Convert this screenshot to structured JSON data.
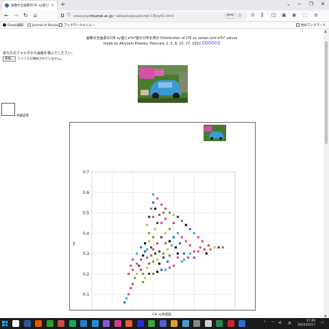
{
  "browser": {
    "tab_title": "画像の全画素のCIE xy値とa*b*値",
    "new_tab": "+",
    "url_prefix": "www.psy.",
    "url_host": "ritsumei.ac.jp",
    "url_path": "/~akitaoka/JavaScript-CIExy01.html",
    "zoom": "80%",
    "bookmarks": [
      "DeepL翻訳",
      "Journal of Illusion",
      "ブックマークメニュー",
      "他のブックマーク"
    ]
  },
  "page": {
    "heading_line1": "画像の全画素のCIE xy値とa*b*値の分布を表示 Distribution of CIE xy values and a*b* values",
    "heading_line2": "made by Akiyoshi Kitaoka, February 2, 5, 8, 10, 17, 2022",
    "heading_link": "000003",
    "prompt": "あなたのフォルダから画像を選んでください。",
    "file_button": "参照...",
    "file_status": "ファイルが選択されていません。",
    "swatch_label": "色確認用",
    "caption": "CIE xy色度図"
  },
  "chart_data": {
    "type": "scatter",
    "title": "",
    "xlabel": "x",
    "ylabel": "y",
    "xlim": [
      0.0,
      0.7
    ],
    "ylim": [
      0.0,
      0.7
    ],
    "xticks": [
      "0.0",
      "0.1",
      "0.2",
      "0.3",
      "0.4",
      "0.5",
      "0.6",
      "0.7"
    ],
    "yticks": [
      "0.0",
      "0.1",
      "0.2",
      "0.3",
      "0.4",
      "0.5",
      "0.6",
      "0.7"
    ],
    "grid": true,
    "point_colors": [
      "#2a6fd6",
      "#37b0e0",
      "#c84dc0",
      "#e0507a",
      "#d84a56",
      "#7a9a3a",
      "#c8c050",
      "#3a4a2a",
      "#9a6a7a",
      "#111111"
    ],
    "points": [
      [
        0.16,
        0.06
      ],
      [
        0.17,
        0.08
      ],
      [
        0.18,
        0.1
      ],
      [
        0.19,
        0.13
      ],
      [
        0.2,
        0.15
      ],
      [
        0.21,
        0.18
      ],
      [
        0.22,
        0.2
      ],
      [
        0.23,
        0.24
      ],
      [
        0.24,
        0.27
      ],
      [
        0.25,
        0.29
      ],
      [
        0.26,
        0.31
      ],
      [
        0.27,
        0.32
      ],
      [
        0.22,
        0.25
      ],
      [
        0.2,
        0.22
      ],
      [
        0.24,
        0.22
      ],
      [
        0.25,
        0.2
      ],
      [
        0.26,
        0.18
      ],
      [
        0.28,
        0.2
      ],
      [
        0.3,
        0.2
      ],
      [
        0.32,
        0.21
      ],
      [
        0.34,
        0.22
      ],
      [
        0.36,
        0.22
      ],
      [
        0.38,
        0.23
      ],
      [
        0.4,
        0.24
      ],
      [
        0.28,
        0.25
      ],
      [
        0.3,
        0.26
      ],
      [
        0.32,
        0.27
      ],
      [
        0.35,
        0.28
      ],
      [
        0.38,
        0.29
      ],
      [
        0.42,
        0.3
      ],
      [
        0.45,
        0.3
      ],
      [
        0.48,
        0.3
      ],
      [
        0.5,
        0.31
      ],
      [
        0.52,
        0.31
      ],
      [
        0.55,
        0.32
      ],
      [
        0.58,
        0.32
      ],
      [
        0.6,
        0.33
      ],
      [
        0.62,
        0.33
      ],
      [
        0.64,
        0.33
      ],
      [
        0.56,
        0.3
      ],
      [
        0.5,
        0.28
      ],
      [
        0.45,
        0.27
      ],
      [
        0.42,
        0.28
      ],
      [
        0.3,
        0.32
      ],
      [
        0.32,
        0.35
      ],
      [
        0.3,
        0.38
      ],
      [
        0.31,
        0.42
      ],
      [
        0.32,
        0.45
      ],
      [
        0.3,
        0.48
      ],
      [
        0.31,
        0.52
      ],
      [
        0.3,
        0.55
      ],
      [
        0.3,
        0.59
      ],
      [
        0.32,
        0.57
      ],
      [
        0.34,
        0.54
      ],
      [
        0.36,
        0.52
      ],
      [
        0.38,
        0.5
      ],
      [
        0.4,
        0.49
      ],
      [
        0.42,
        0.48
      ],
      [
        0.44,
        0.46
      ],
      [
        0.46,
        0.44
      ],
      [
        0.48,
        0.42
      ],
      [
        0.5,
        0.4
      ],
      [
        0.52,
        0.38
      ],
      [
        0.54,
        0.36
      ],
      [
        0.4,
        0.45
      ],
      [
        0.38,
        0.42
      ],
      [
        0.36,
        0.4
      ],
      [
        0.34,
        0.38
      ],
      [
        0.36,
        0.35
      ],
      [
        0.38,
        0.36
      ],
      [
        0.4,
        0.38
      ],
      [
        0.42,
        0.4
      ],
      [
        0.44,
        0.38
      ],
      [
        0.46,
        0.36
      ],
      [
        0.48,
        0.34
      ],
      [
        0.28,
        0.4
      ],
      [
        0.27,
        0.44
      ],
      [
        0.28,
        0.48
      ],
      [
        0.29,
        0.52
      ],
      [
        0.26,
        0.35
      ],
      [
        0.24,
        0.33
      ],
      [
        0.22,
        0.3
      ],
      [
        0.2,
        0.27
      ],
      [
        0.19,
        0.24
      ],
      [
        0.18,
        0.2
      ],
      [
        0.35,
        0.3
      ],
      [
        0.37,
        0.32
      ],
      [
        0.33,
        0.31
      ],
      [
        0.29,
        0.29
      ],
      [
        0.41,
        0.33
      ],
      [
        0.43,
        0.35
      ],
      [
        0.39,
        0.34
      ],
      [
        0.34,
        0.45
      ],
      [
        0.36,
        0.47
      ],
      [
        0.33,
        0.49
      ],
      [
        0.35,
        0.5
      ],
      [
        0.28,
        0.36
      ],
      [
        0.31,
        0.3
      ],
      [
        0.27,
        0.28
      ],
      [
        0.33,
        0.25
      ],
      [
        0.37,
        0.26
      ],
      [
        0.44,
        0.26
      ],
      [
        0.47,
        0.28
      ],
      [
        0.53,
        0.33
      ],
      [
        0.57,
        0.34
      ],
      [
        0.25,
        0.16
      ],
      [
        0.27,
        0.23
      ],
      [
        0.29,
        0.33
      ]
    ]
  },
  "taskbar": {
    "time": "17:49",
    "date": "2022/02/17",
    "apps": [
      "#ffffff",
      "#2b5797",
      "#e05a00",
      "#2d9c2d",
      "#d04a4a",
      "#1aa55a",
      "#2a7ad6",
      "#1a8fe0",
      "#8a5ad6",
      "#d83a8a",
      "#e85a2a",
      "#2a2ad6",
      "#3aa53a",
      "#5a5ad6",
      "#e0a030",
      "#4a9ad6",
      "#888888",
      "#d0d0d0",
      "#2a8a4a",
      "#c82a2a",
      "#2a6ad6"
    ]
  }
}
